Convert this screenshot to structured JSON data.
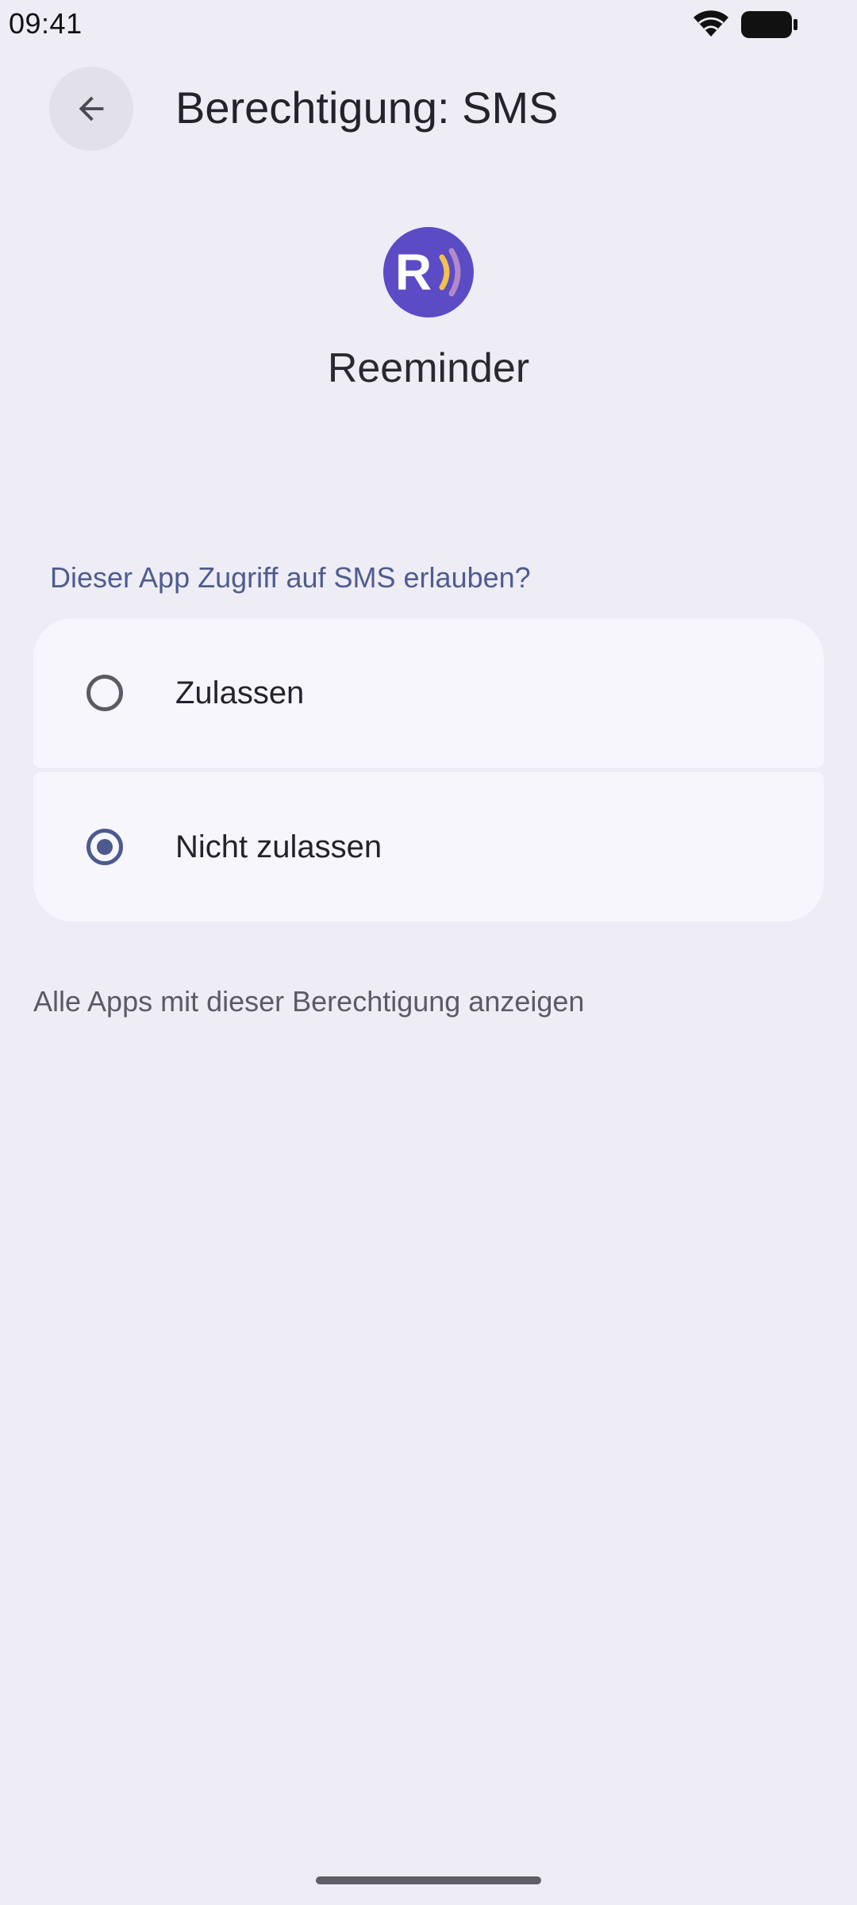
{
  "status_bar": {
    "time": "09:41",
    "icons": [
      "wifi-icon",
      "battery-icon"
    ]
  },
  "header": {
    "back_icon": "arrow-left-icon",
    "title": "Berechtigung: SMS"
  },
  "app": {
    "icon": "reeminder-app-icon",
    "icon_letter": "R",
    "name": "Reeminder"
  },
  "permission": {
    "question": "Dieser App Zugriff auf SMS erlauben?",
    "options": [
      {
        "label": "Zulassen",
        "selected": false
      },
      {
        "label": "Nicht zulassen",
        "selected": true
      }
    ]
  },
  "footer": {
    "all_apps_link": "Alle Apps mit dieser Berechtigung anzeigen"
  },
  "colors": {
    "background": "#eeecf5",
    "card": "#f8f6fd",
    "accent": "#4c5a8e",
    "app_icon_bg": "#5b4bc4",
    "app_icon_wave": "#f2c14e"
  }
}
